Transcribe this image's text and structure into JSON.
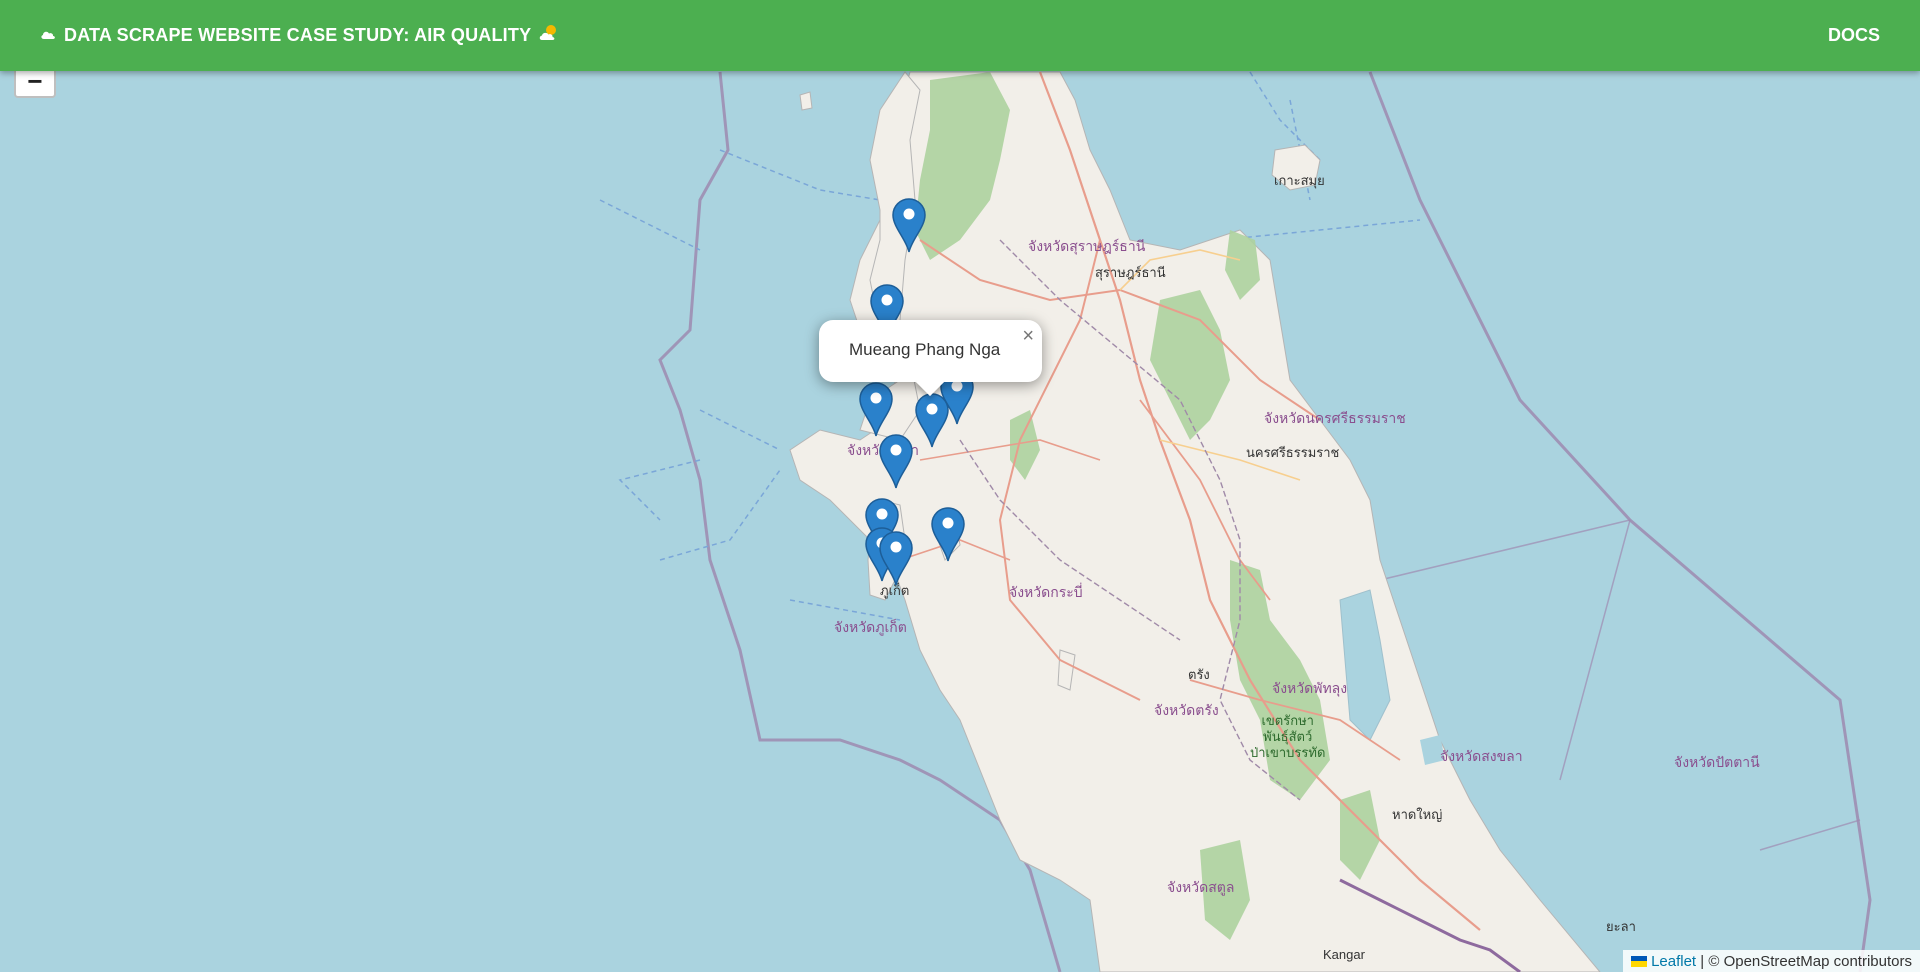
{
  "header": {
    "title": "DATA SCRAPE WEBSITE CASE STUDY: AIR QUALITY",
    "docs_label": "DOCS"
  },
  "map": {
    "zoom_out_label": "−",
    "popup": {
      "text": "Mueang Phang Nga",
      "close_label": "×"
    },
    "attribution": {
      "leaflet_label": "Leaflet",
      "separator": " | ",
      "osm_label": "© OpenStreetMap contributors"
    },
    "place_labels": {
      "koh_samui": "เกาะสมุย",
      "surat_province": "จังหวัดสุราษฎร์ธานี",
      "surat_city": "สุราษฎร์ธานี",
      "nakhon_province": "จังหวัดนครศรีธรรมราช",
      "nakhon_city": "นครศรีธรรมราช",
      "phangnga_province": "จังหวัดพังงา",
      "phuket_city": "ภูเก็ต",
      "phuket_province": "จังหวัดภูเก็ต",
      "krabi_province": "จังหวัดกระบี่",
      "trang_city": "ตรัง",
      "trang_province": "จังหวัดตรัง",
      "phatthalung_province": "จังหวัดพัทลุง",
      "park_line1": "เขตรักษา",
      "park_line2": "พันธุ์สัตว์",
      "park_line3": "ป่าเขาบรรทัด",
      "songkhla_province": "จังหวัดสงขลา",
      "pattani_province": "จังหวัดปัตตานี",
      "hatyai_city": "หาดใหญ่",
      "satun_province": "จังหวัดสตูล",
      "yala_city": "ยะลา",
      "kangar_city": "Kangar"
    },
    "marker_color": "#2a81cb"
  }
}
